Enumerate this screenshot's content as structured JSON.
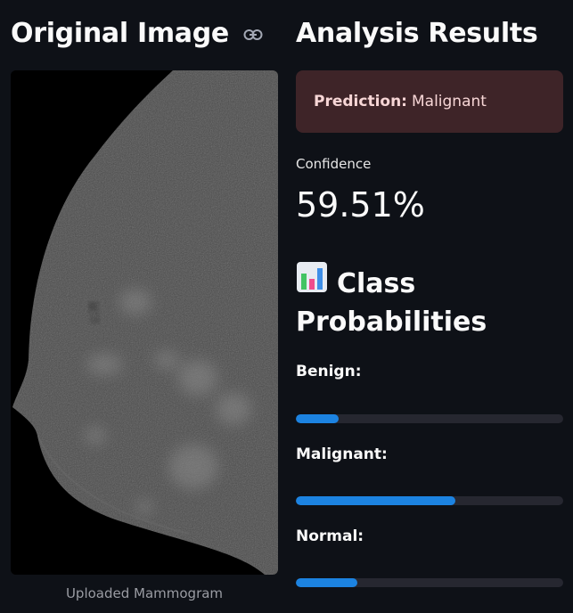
{
  "left": {
    "title": "Original Image",
    "caption": "Uploaded Mammogram"
  },
  "right": {
    "title": "Analysis Results",
    "prediction_label": "Prediction:",
    "prediction_value": "Malignant",
    "confidence_label": "Confidence",
    "confidence_value": "59.51%",
    "class_prob_title_line1": "Class",
    "class_prob_title_line2": "Probabilities",
    "probabilities": [
      {
        "label": "Benign:",
        "fraction": 0.16
      },
      {
        "label": "Malignant:",
        "fraction": 0.5951
      },
      {
        "label": "Normal:",
        "fraction": 0.23
      }
    ]
  },
  "colors": {
    "background": "#0e1117",
    "prediction_bg": "#3e2428",
    "progress_fill": "#1c83e1",
    "progress_track": "#262730"
  },
  "icons": [
    "link-icon",
    "bar-chart-icon"
  ]
}
